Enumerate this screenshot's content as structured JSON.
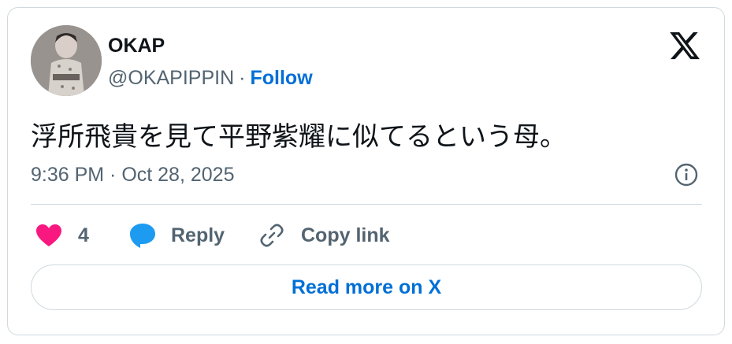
{
  "author": {
    "name": "OKAP",
    "handle": "@OKAPIPPIN",
    "separator": "·",
    "follow_label": "Follow",
    "avatar_icon": "profile-photo"
  },
  "brand_icon": "x-logo",
  "tweet": {
    "text": "浮所飛貴を見て平野紫耀に似てるという母。",
    "timestamp": "9:36 PM · Oct 28, 2025"
  },
  "actions": {
    "like_count": "4",
    "reply_label": "Reply",
    "copy_label": "Copy link"
  },
  "read_more_label": "Read more on X",
  "colors": {
    "accent": "#006fd6",
    "like": "#f91880",
    "reply": "#1d9bf0",
    "secondary_text": "#536471",
    "border": "#cfd9de"
  }
}
